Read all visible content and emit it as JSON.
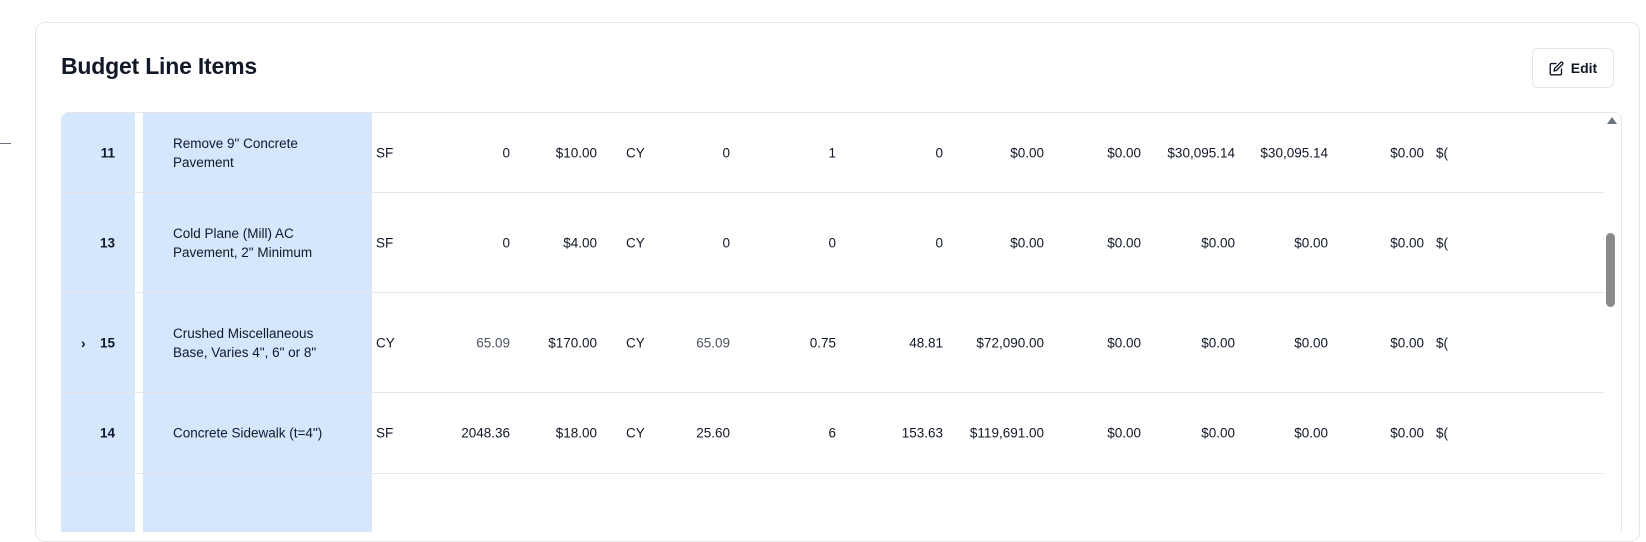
{
  "card": {
    "title": "Budget Line Items",
    "edit_label": "Edit"
  },
  "rows": [
    {
      "num": "11",
      "expandable": false,
      "description": "Remove 9\" Concrete Pavement",
      "unit": "SF",
      "qty": "0",
      "unit_price": "$10.00",
      "conv_unit": "CY",
      "conv_qty": "0",
      "factor": "1",
      "total_qty": "0",
      "amount": "$0.00",
      "c1": "$0.00",
      "c2": "$30,095.14",
      "c3": "$30,095.14",
      "c4": "$0.00",
      "c5": "$("
    },
    {
      "num": "13",
      "expandable": false,
      "description": "Cold Plane (Mill) AC Pavement, 2\" Minimum",
      "unit": "SF",
      "qty": "0",
      "unit_price": "$4.00",
      "conv_unit": "CY",
      "conv_qty": "0",
      "factor": "0",
      "total_qty": "0",
      "amount": "$0.00",
      "c1": "$0.00",
      "c2": "$0.00",
      "c3": "$0.00",
      "c4": "$0.00",
      "c5": "$("
    },
    {
      "num": "15",
      "expandable": true,
      "description": "Crushed Miscellaneous Base, Varies 4\", 6\" or 8\"",
      "unit": "CY",
      "qty": "65.09",
      "unit_price": "$170.00",
      "conv_unit": "CY",
      "conv_qty": "65.09",
      "factor": "0.75",
      "total_qty": "48.81",
      "amount": "$72,090.00",
      "c1": "$0.00",
      "c2": "$0.00",
      "c3": "$0.00",
      "c4": "$0.00",
      "c5": "$("
    },
    {
      "num": "14",
      "expandable": false,
      "description": "Concrete Sidewalk (t=4\")",
      "unit": "SF",
      "qty": "2048.36",
      "unit_price": "$18.00",
      "conv_unit": "CY",
      "conv_qty": "25.60",
      "factor": "6",
      "total_qty": "153.63",
      "amount": "$119,691.00",
      "c1": "$0.00",
      "c2": "$0.00",
      "c3": "$0.00",
      "c4": "$0.00",
      "c5": "$("
    },
    {
      "num": "",
      "expandable": false,
      "description": "",
      "unit": "",
      "qty": "",
      "unit_price": "",
      "conv_unit": "",
      "conv_qty": "",
      "factor": "",
      "total_qty": "",
      "amount": "",
      "c1": "",
      "c2": "",
      "c3": "",
      "c4": "",
      "c5": ""
    }
  ],
  "icons": {
    "edit": "pencil-square-icon",
    "expand": "chevron-right-icon",
    "scroll_up": "caret-up-icon"
  },
  "colors": {
    "frozen_column_bg": "#d5e7fc",
    "border": "#e5e7eb",
    "muted_text": "#4b5563"
  }
}
